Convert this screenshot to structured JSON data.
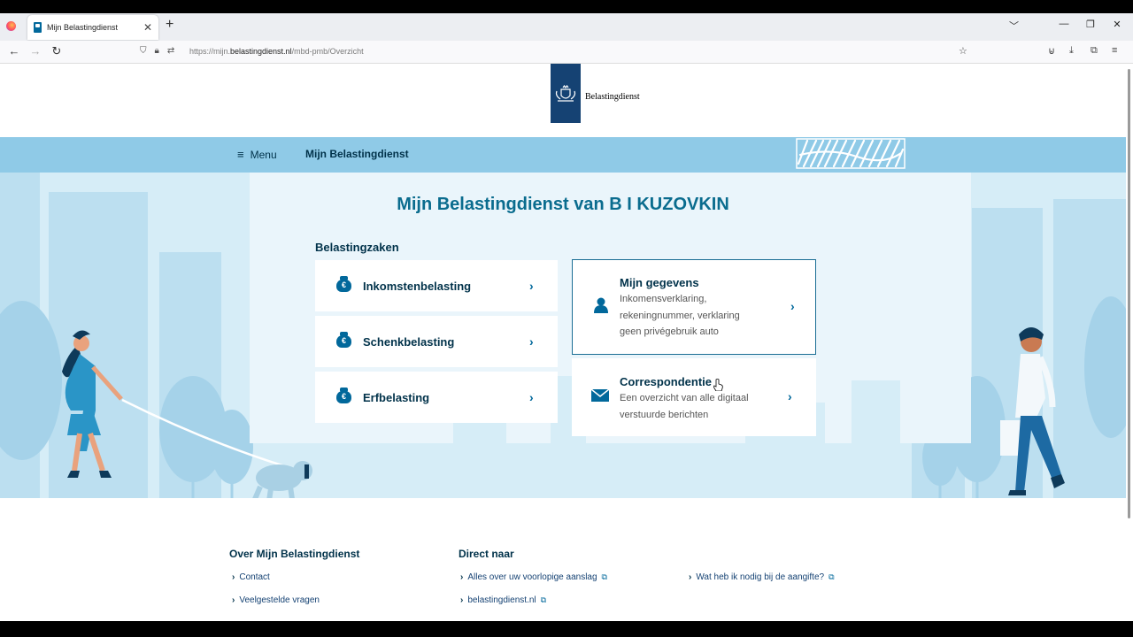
{
  "browser": {
    "tab_title": "Mijn Belastingdienst",
    "tab_close": "✕",
    "new_tab": "+",
    "url_prefix": "https://mijn.",
    "url_domain": "belastingdienst.nl",
    "url_path": "/mbd-pmb/Overzicht"
  },
  "brand": {
    "name": "Belastingdienst",
    "primary_color": "#154273",
    "accent_color": "#8fcae7"
  },
  "topbar": {
    "menu_label": "Menu",
    "site_link": "Mijn Belastingdienst"
  },
  "main": {
    "title": "Mijn Belastingdienst van B I KUZOVKIN",
    "section_label": "Belastingzaken",
    "tax_cards": [
      {
        "label": "Inkomstenbelasting",
        "icon": "money-bag-icon"
      },
      {
        "label": "Schenkbelasting",
        "icon": "money-bag-icon"
      },
      {
        "label": "Erfbelasting",
        "icon": "money-bag-icon"
      }
    ],
    "gegevens": {
      "title": "Mijn gegevens",
      "desc_lines": [
        "Inkomensverklaring,",
        "rekeningnummer, verklaring",
        "geen privégebruik auto"
      ],
      "icon": "person-icon"
    },
    "correspondentie": {
      "title": "Correspondentie",
      "desc_lines": [
        "Een overzicht van alle digitaal",
        "verstuurde berichten"
      ],
      "icon": "envelope-icon"
    }
  },
  "footer": {
    "col1_title": "Over Mijn Belastingdienst",
    "col1_links": [
      "Contact",
      "Veelgestelde vragen"
    ],
    "col2_title": "Direct naar",
    "col2_links": [
      "Alles over uw voorlopige aanslag",
      "belastingdienst.nl"
    ],
    "col3_links": [
      "Wat heb ik nodig bij de aangifte?"
    ]
  }
}
